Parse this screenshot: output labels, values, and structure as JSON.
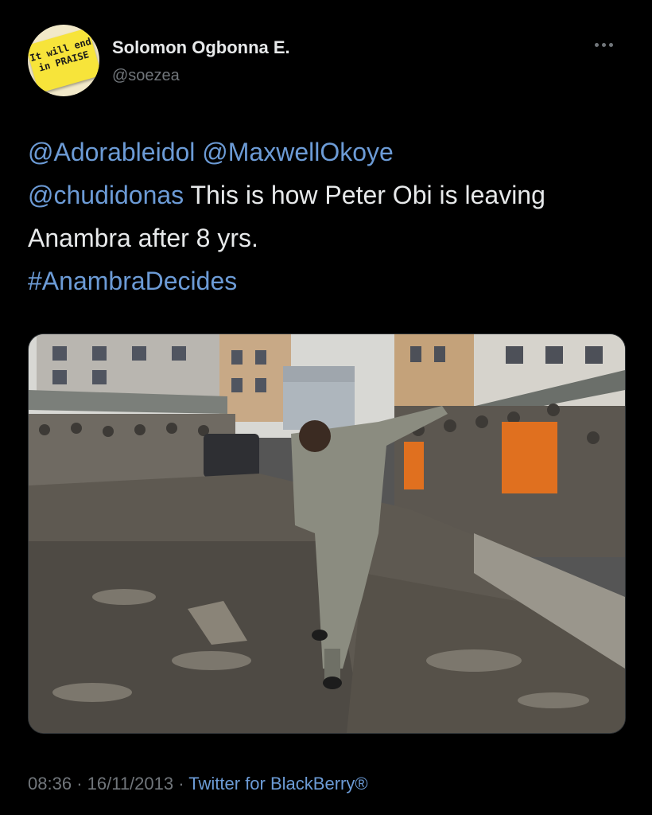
{
  "user": {
    "display_name": "Solomon Ogbonna E.",
    "handle": "@soezea",
    "avatar_text": "It will end\nin PRAISE"
  },
  "tweet": {
    "mention_1": "@Adorableidol",
    "mention_2": "@MaxwellOkoye",
    "mention_3": "@chudidonas",
    "body": " This is how Peter Obi is leaving Anambra after 8 yrs.",
    "hashtag": "#AnambraDecides"
  },
  "meta": {
    "time": "08:36",
    "date": "16/11/2013",
    "source": "Twitter for BlackBerry®",
    "separator": "·"
  },
  "colors": {
    "background": "#000000",
    "text": "#e7e9ea",
    "secondary": "#71767b",
    "link": "#6c9bd6"
  },
  "icons": {
    "more": "more-horizontal-icon"
  }
}
